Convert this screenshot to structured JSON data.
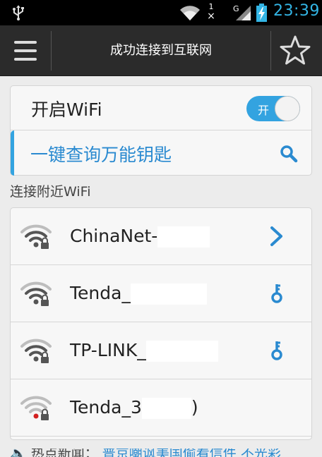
{
  "statusbar": {
    "time": "23:39",
    "time_color": "#33b5e5",
    "icons": [
      "usb-icon",
      "wifi-signal-icon",
      "notification-icon",
      "cell-signal-icon",
      "battery-charging-icon"
    ],
    "noti_line1": "1",
    "noti_line2": "×",
    "signal_label": "G"
  },
  "header": {
    "title": "成功连接到互联网",
    "menu_icon": "menu-icon",
    "star_icon": "star-icon"
  },
  "wifi_card": {
    "toggle_label": "开启WiFi",
    "toggle_state": "开",
    "toggle_on": true,
    "key_search_label": "一键查询万能钥匙",
    "accent_color": "#33a3e0"
  },
  "section_title": "连接附近WiFi",
  "networks": [
    {
      "name": "ChinaNet-",
      "action": "chevron-right-icon",
      "signal": "strong",
      "locked": true
    },
    {
      "name": "Tenda_",
      "action": "key-icon",
      "signal": "strong",
      "locked": true
    },
    {
      "name": "TP-LINK_",
      "action": "key-icon",
      "signal": "strong",
      "locked": true
    },
    {
      "name": "Tenda_3",
      "name_tail": ")",
      "action": "none",
      "signal": "weak",
      "locked": true
    }
  ],
  "news": {
    "label": "热点新闻：",
    "text": "普京嘲讽美国偷看信件 不光彩"
  }
}
